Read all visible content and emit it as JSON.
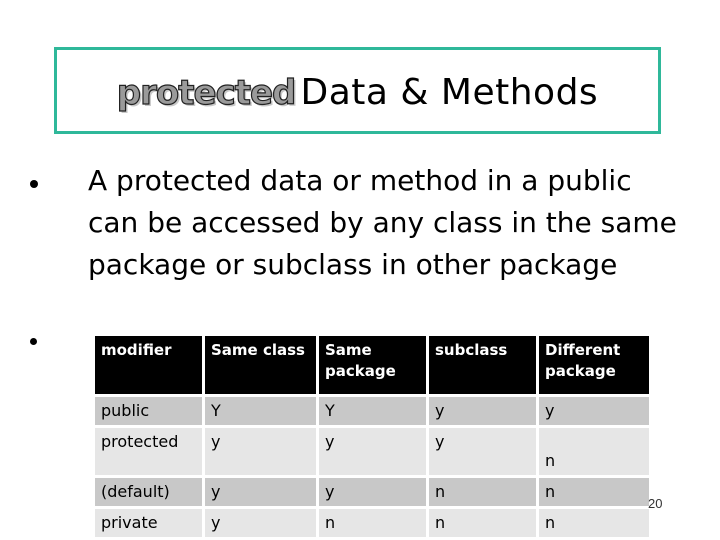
{
  "slide": {
    "title": {
      "keyword": "protected",
      "rest": "Data & Methods"
    },
    "bullets": [
      {
        "text": "A protected data or method in a public can be accessed by any class in the same package or subclass in other package"
      },
      {
        "text": ""
      }
    ],
    "table": {
      "headers": [
        "modifier",
        "Same class",
        "Same package",
        "subclass",
        "Different package"
      ],
      "rows": [
        {
          "modifier": "public",
          "cells": [
            "Y",
            "Y",
            "y",
            "y"
          ]
        },
        {
          "modifier": "protected",
          "cells": [
            "y",
            "y",
            "y",
            "n"
          ]
        },
        {
          "modifier": "(default)",
          "cells": [
            "y",
            "y",
            "n",
            "n"
          ]
        },
        {
          "modifier": "private",
          "cells": [
            "y",
            "n",
            "n",
            "n"
          ]
        }
      ]
    },
    "page_number_fragment": "20"
  },
  "colors": {
    "title_border": "#2fb89a",
    "header_bg": "#000000",
    "row_dark": "#c8c8c8",
    "row_light": "#e6e6e6"
  }
}
